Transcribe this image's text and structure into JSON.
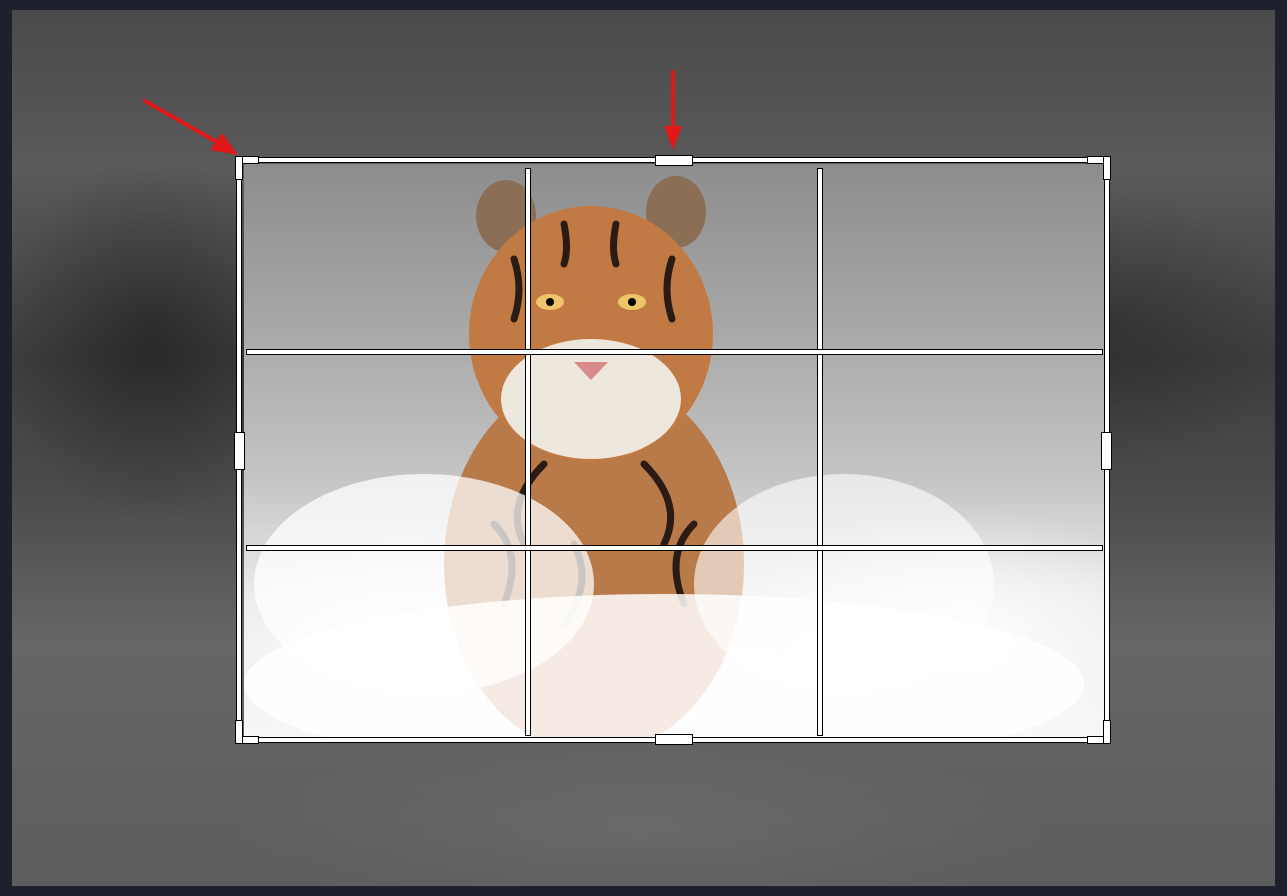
{
  "editor": {
    "mode": "crop",
    "tool": "crop-with-rule-of-thirds-grid",
    "grid_divisions": 3,
    "image_subject_icon": "tiger-running-in-snow-photo"
  },
  "colors": {
    "page_background": "#1c212b",
    "grid_line": "#ffffff",
    "grid_outline": "#000000",
    "annotation_arrow": "#e01818"
  },
  "annotations": {
    "arrows": [
      {
        "icon": "red-arrow-icon",
        "points_to": "top-left-corner-handle"
      },
      {
        "icon": "red-arrow-icon",
        "points_to": "top-edge-handle"
      }
    ]
  }
}
